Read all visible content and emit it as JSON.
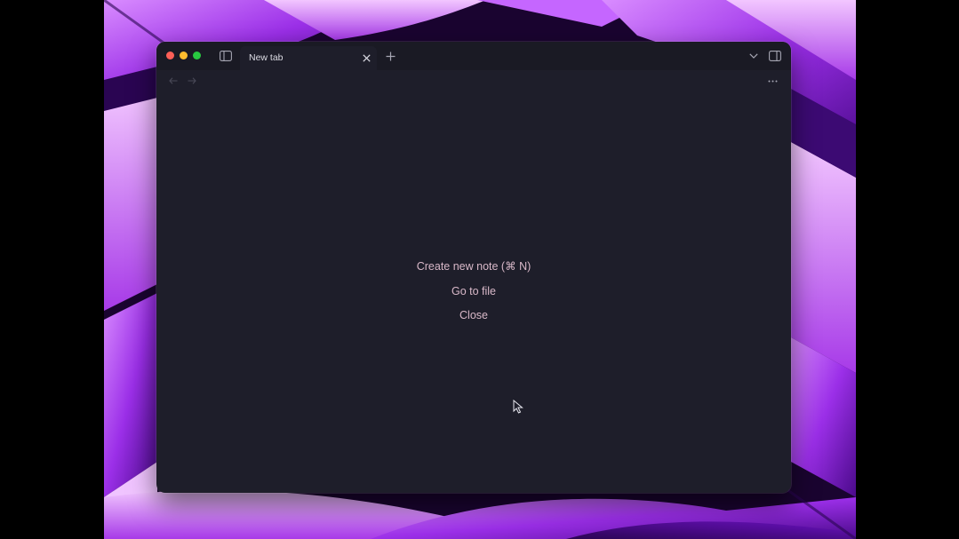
{
  "window": {
    "traffic_lights": {
      "close_color": "#fe5f57",
      "minimize_color": "#febc2e",
      "zoom_color": "#28c840"
    },
    "titlebar_icons": {
      "sidebar_toggle": "sidebar-left-icon",
      "new_tab": "plus-icon",
      "tab_list": "chevron-down-icon",
      "right_sidebar_toggle": "sidebar-right-icon"
    },
    "tab": {
      "label": "New tab",
      "close_icon": "close-icon"
    },
    "nav": {
      "back_icon": "arrow-left-icon",
      "forward_icon": "arrow-right-icon",
      "more_icon": "more-horizontal-icon"
    }
  },
  "empty_state": {
    "actions": [
      {
        "label": "Create new note (⌘ N)"
      },
      {
        "label": "Go to file"
      },
      {
        "label": "Close"
      }
    ],
    "link_color": "#d8b8c8"
  },
  "colors": {
    "window_bg": "#1e1e2a",
    "titlebar_bg": "#1a1a24",
    "wallpaper_accent": "#a93ef0"
  }
}
